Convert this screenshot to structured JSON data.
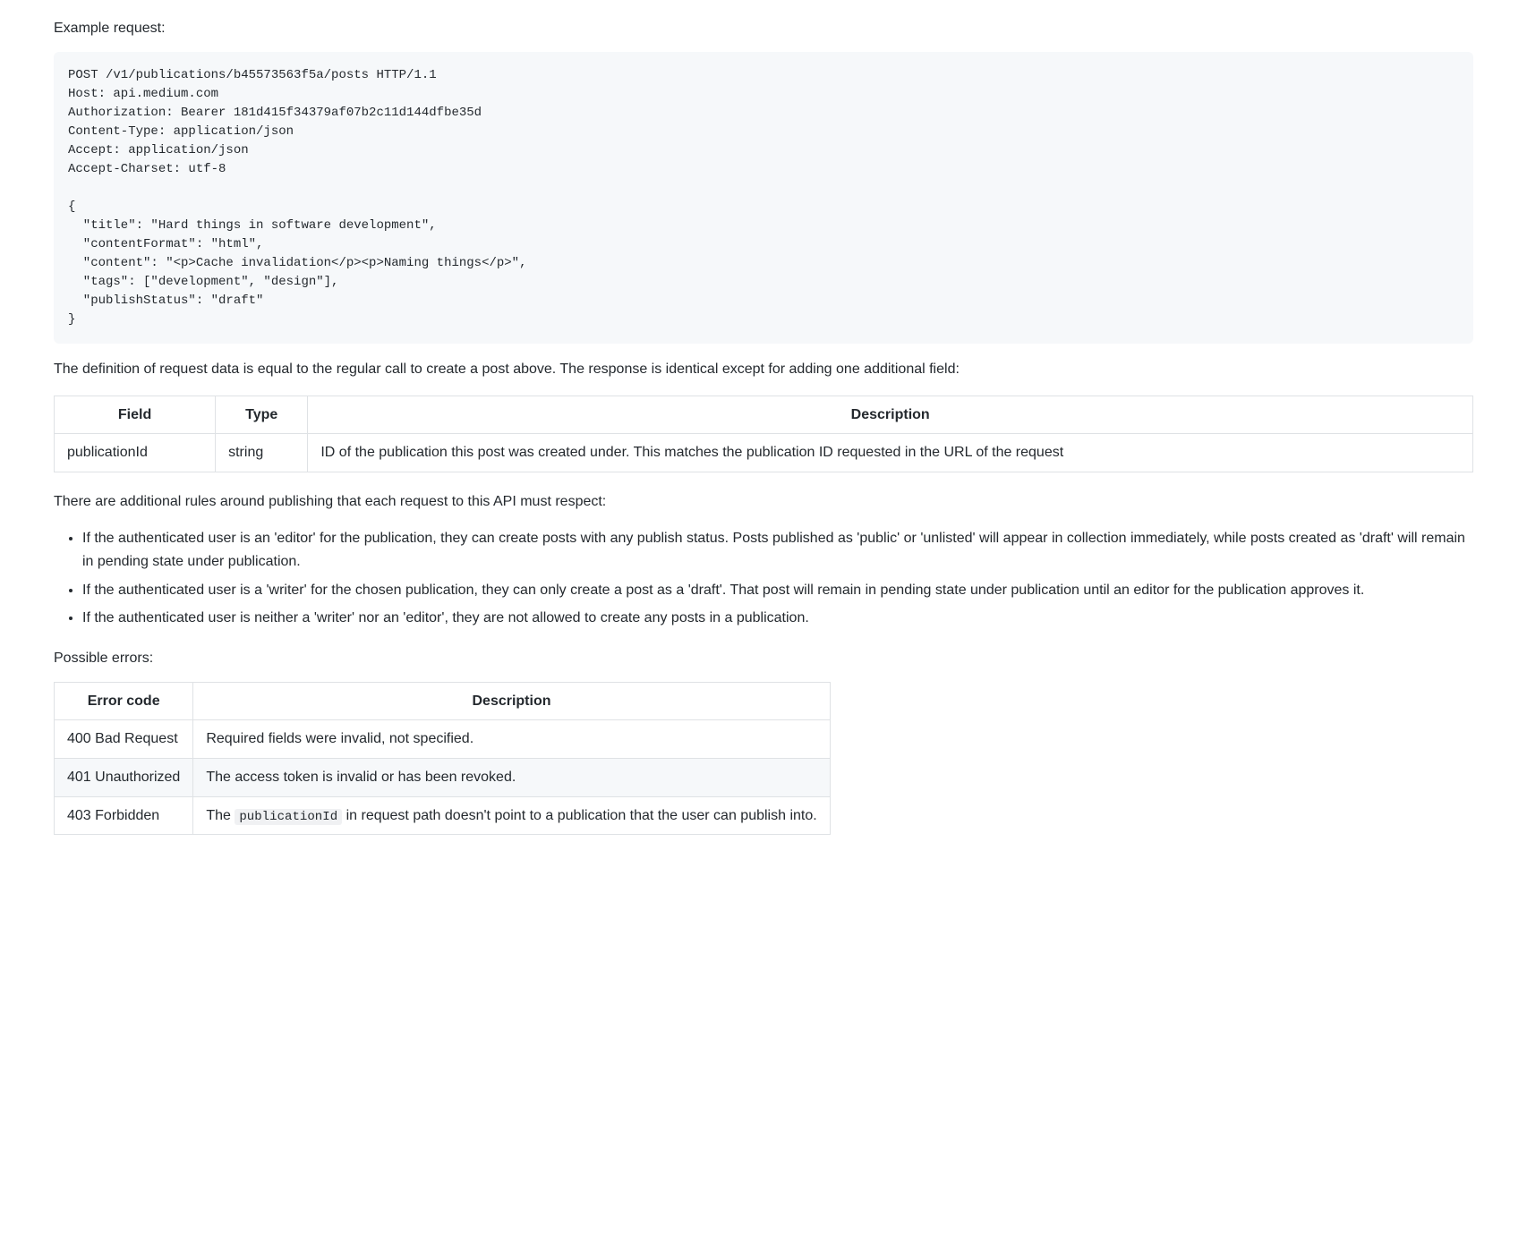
{
  "labels": {
    "example_request": "Example request:",
    "definition_text": "The definition of request data is equal to the regular call to create a post above. The response is identical except for adding one additional field:",
    "rules_intro": "There are additional rules around publishing that each request to this API must respect:",
    "possible_errors": "Possible errors:"
  },
  "code_block": "POST /v1/publications/b45573563f5a/posts HTTP/1.1\nHost: api.medium.com\nAuthorization: Bearer 181d415f34379af07b2c11d144dfbe35d\nContent-Type: application/json\nAccept: application/json\nAccept-Charset: utf-8\n\n{\n  \"title\": \"Hard things in software development\",\n  \"contentFormat\": \"html\",\n  \"content\": \"<p>Cache invalidation</p><p>Naming things</p>\",\n  \"tags\": [\"development\", \"design\"],\n  \"publishStatus\": \"draft\"\n}",
  "field_table": {
    "headers": {
      "field": "Field",
      "type": "Type",
      "description": "Description"
    },
    "row": {
      "field": "publicationId",
      "type": "string",
      "description": "ID of the publication this post was created under. This matches the publication ID requested in the URL of the request"
    }
  },
  "rules": {
    "item1": "If the authenticated user is an 'editor' for the publication, they can create posts with any publish status. Posts published as 'public' or 'unlisted' will appear in collection immediately, while posts created as 'draft' will remain in pending state under publication.",
    "item2": "If the authenticated user is a 'writer' for the chosen publication, they can only create a post as a 'draft'. That post will remain in pending state under publication until an editor for the publication approves it.",
    "item3": "If the authenticated user is neither a 'writer' nor an 'editor', they are not allowed to create any posts in a publication."
  },
  "error_table": {
    "headers": {
      "code": "Error code",
      "description": "Description"
    },
    "rows": {
      "r1": {
        "code": "400 Bad Request",
        "description": "Required fields were invalid, not specified."
      },
      "r2": {
        "code": "401 Unauthorized",
        "description": "The access token is invalid or has been revoked."
      },
      "r3": {
        "code": "403 Forbidden",
        "prefix": "The ",
        "code_token": "publicationId",
        "suffix": " in request path doesn't point to a publication that the user can publish into."
      }
    }
  }
}
